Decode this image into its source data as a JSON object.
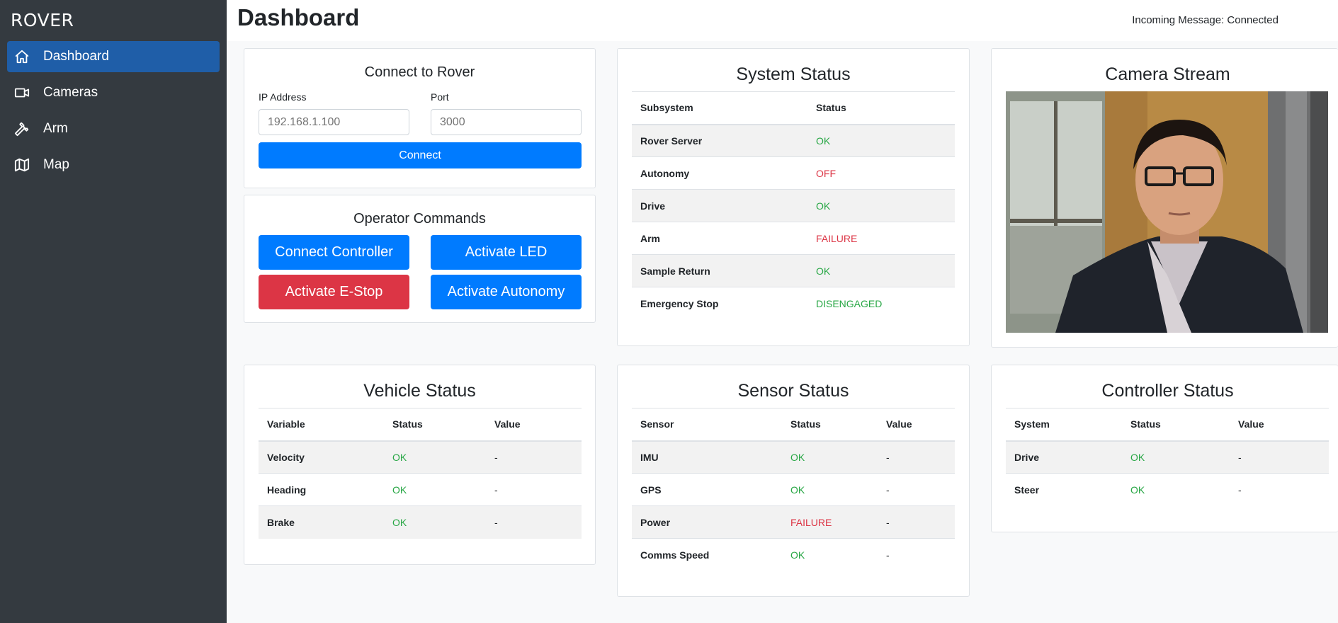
{
  "app": {
    "brand": "ROVER"
  },
  "sidebar": {
    "items": [
      {
        "label": "Dashboard",
        "icon": "home-icon",
        "active": true
      },
      {
        "label": "Cameras",
        "icon": "video-camera-icon"
      },
      {
        "label": "Arm",
        "icon": "wrench-icon"
      },
      {
        "label": "Map",
        "icon": "map-icon"
      }
    ]
  },
  "header": {
    "title": "Dashboard",
    "incoming_message": "Incoming Message: Connected"
  },
  "connect": {
    "title": "Connect to Rover",
    "ip_label": "IP Address",
    "ip_placeholder": "192.168.1.100",
    "port_label": "Port",
    "port_placeholder": "3000",
    "connect_label": "Connect"
  },
  "operator": {
    "title": "Operator Commands",
    "connect_controller": "Connect Controller",
    "activate_led": "Activate LED",
    "activate_estop": "Activate E-Stop",
    "activate_autonomy": "Activate Autonomy"
  },
  "system_status": {
    "title": "System Status",
    "headers": [
      "Subsystem",
      "Status"
    ],
    "rows": [
      {
        "name": "Rover Server",
        "status": "OK",
        "level": "ok"
      },
      {
        "name": "Autonomy",
        "status": "OFF",
        "level": "bad"
      },
      {
        "name": "Drive",
        "status": "OK",
        "level": "ok"
      },
      {
        "name": "Arm",
        "status": "FAILURE",
        "level": "bad"
      },
      {
        "name": "Sample Return",
        "status": "OK",
        "level": "ok"
      },
      {
        "name": "Emergency Stop",
        "status": "DISENGAGED",
        "level": "ok"
      }
    ]
  },
  "camera": {
    "title": "Camera Stream"
  },
  "vehicle_status": {
    "title": "Vehicle Status",
    "headers": [
      "Variable",
      "Status",
      "Value"
    ],
    "rows": [
      {
        "name": "Velocity",
        "status": "OK",
        "value": "-",
        "level": "ok"
      },
      {
        "name": "Heading",
        "status": "OK",
        "value": "-",
        "level": "ok"
      },
      {
        "name": "Brake",
        "status": "OK",
        "value": "-",
        "level": "ok"
      }
    ]
  },
  "sensor_status": {
    "title": "Sensor Status",
    "headers": [
      "Sensor",
      "Status",
      "Value"
    ],
    "rows": [
      {
        "name": "IMU",
        "status": "OK",
        "value": "-",
        "level": "ok"
      },
      {
        "name": "GPS",
        "status": "OK",
        "value": "-",
        "level": "ok"
      },
      {
        "name": "Power",
        "status": "FAILURE",
        "value": "-",
        "level": "bad"
      },
      {
        "name": "Comms Speed",
        "status": "OK",
        "value": "-",
        "level": "ok"
      }
    ]
  },
  "controller_status": {
    "title": "Controller Status",
    "headers": [
      "System",
      "Status",
      "Value"
    ],
    "rows": [
      {
        "name": "Drive",
        "status": "OK",
        "value": "-",
        "level": "ok"
      },
      {
        "name": "Steer",
        "status": "OK",
        "value": "-",
        "level": "ok"
      }
    ]
  },
  "colors": {
    "sidebar": "#343a40",
    "active": "#1f5ea8",
    "primary": "#007bff",
    "danger": "#dc3545",
    "ok": "#28a745"
  }
}
